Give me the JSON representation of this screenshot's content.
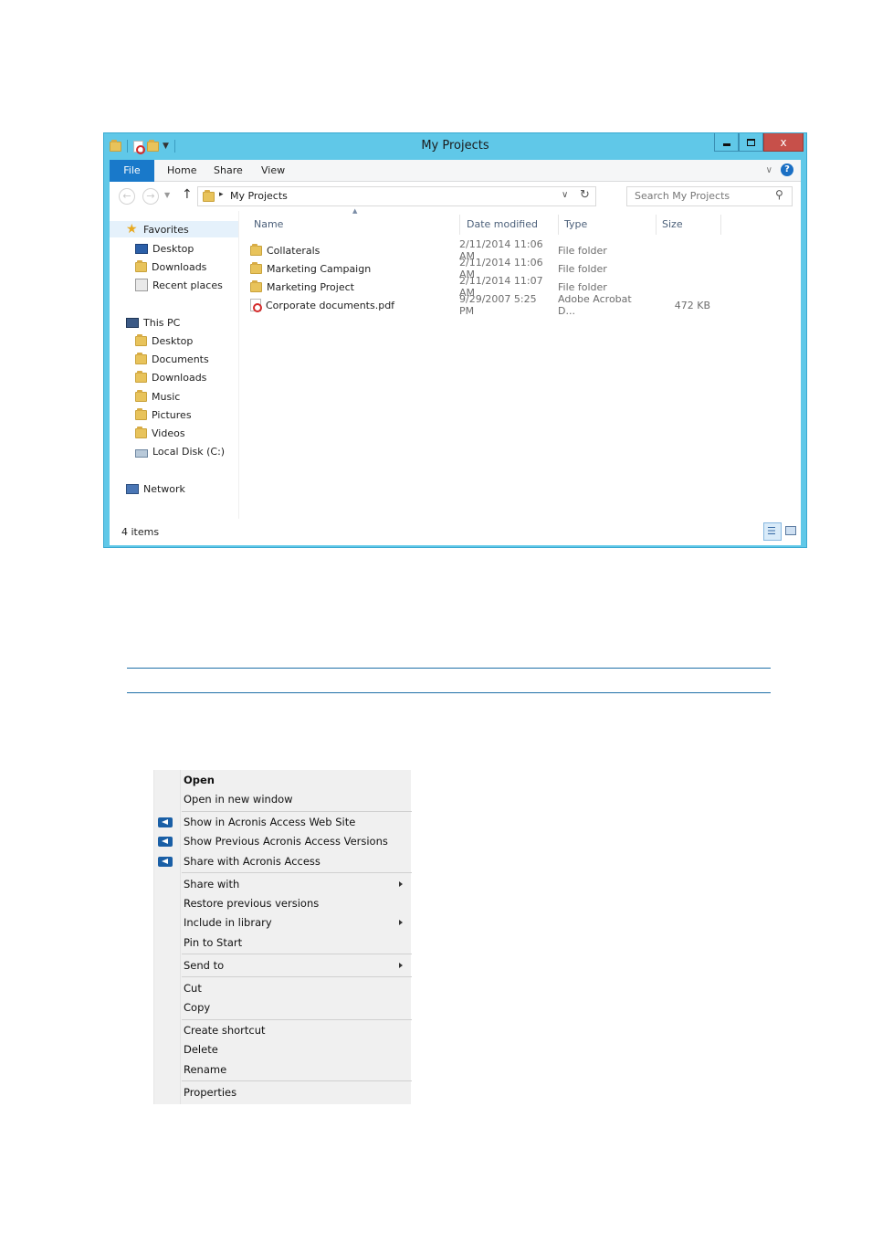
{
  "window": {
    "title": "My Projects",
    "controls": {
      "minimize": "minimize",
      "maximize": "maximize",
      "close": "x"
    }
  },
  "ribbon": {
    "tabs": [
      "File",
      "Home",
      "Share",
      "View"
    ],
    "help": "?"
  },
  "address": {
    "path": "My Projects",
    "search_placeholder": "Search My Projects"
  },
  "nav": {
    "favorites": {
      "label": "Favorites",
      "items": [
        "Desktop",
        "Downloads",
        "Recent places"
      ]
    },
    "this_pc": {
      "label": "This PC",
      "items": [
        "Desktop",
        "Documents",
        "Downloads",
        "Music",
        "Pictures",
        "Videos",
        "Local Disk (C:)"
      ]
    },
    "network": "Network"
  },
  "columns": [
    "Name",
    "Date modified",
    "Type",
    "Size"
  ],
  "files": [
    {
      "name": "Collaterals",
      "date": "2/11/2014 11:06 AM",
      "type": "File folder",
      "size": "",
      "icon": "folder-icon"
    },
    {
      "name": "Marketing Campaign",
      "date": "2/11/2014 11:06 AM",
      "type": "File folder",
      "size": "",
      "icon": "folder-icon"
    },
    {
      "name": "Marketing Project",
      "date": "2/11/2014 11:07 AM",
      "type": "File folder",
      "size": "",
      "icon": "folder-icon"
    },
    {
      "name": "Corporate documents.pdf",
      "date": "9/29/2007 5:25 PM",
      "type": "Adobe Acrobat D...",
      "size": "472 KB",
      "icon": "pdf-icon"
    }
  ],
  "status": {
    "items": "4 items"
  },
  "context_menu": {
    "open": "Open",
    "open_new_window": "Open in new window",
    "show_web": "Show in Acronis Access Web Site",
    "show_prev": "Show Previous Acronis Access Versions",
    "share_acronis": "Share with Acronis Access",
    "share_with": "Share with",
    "restore": "Restore previous versions",
    "include_library": "Include in library",
    "pin_start": "Pin to Start",
    "send_to": "Send to",
    "cut": "Cut",
    "copy": "Copy",
    "create_shortcut": "Create shortcut",
    "delete": "Delete",
    "rename": "Rename",
    "properties": "Properties"
  }
}
